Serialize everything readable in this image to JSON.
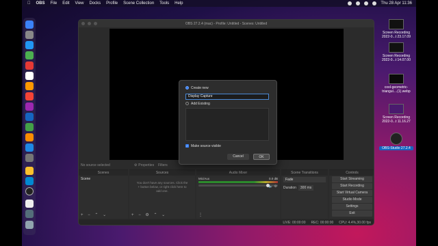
{
  "menubar": {
    "items": [
      "OBS",
      "File",
      "Edit",
      "View",
      "Docks",
      "Profile",
      "Scene Collection",
      "Tools",
      "Help"
    ],
    "clock": "Thu 28 Apr  11:36"
  },
  "obs": {
    "window_title": "OBS 27.2.4 (mac) - Profile: Untitled - Scenes: Untitled",
    "no_source": "No source selected",
    "properties_label": "Properties",
    "filters_label": "Filters",
    "docks": {
      "scenes_title": "Scenes",
      "scene_item": "Scene",
      "sources_title": "Sources",
      "sources_empty": "You don't have any sources. Click the + button below, or right click here to add one.",
      "mixer_title": "Audio Mixer",
      "mixer_track": "Mic/Aux",
      "mixer_db": "0.0 dB",
      "transitions_title": "Scene Transitions",
      "transition_value": "Fade",
      "duration_label": "Duration",
      "duration_value": "300 ms",
      "controls_title": "Controls",
      "controls": [
        "Start Streaming",
        "Start Recording",
        "Start Virtual Camera",
        "Studio Mode",
        "Settings",
        "Exit"
      ]
    },
    "status": {
      "live": "LIVE: 00:00:00",
      "rec": "REC: 00:00:00",
      "cpu": "CPU: 4.4%,30.00 fps"
    }
  },
  "dialog": {
    "create_new": "Create new",
    "name_value": "Display Capture",
    "add_existing": "Add Existing",
    "make_visible": "Make source visible",
    "cancel": "Cancel",
    "ok": "OK"
  },
  "desktop": [
    {
      "name": "Screen Recording\n2022-0...t 23.17.09"
    },
    {
      "name": "Screen Recording\n2022-0...t 14.07.00"
    },
    {
      "name": "cool-geometric-\ntriangul....(1).webp"
    },
    {
      "name": "Screen Recording\n2022-0...t 11.16.27"
    },
    {
      "name": "OBS-Studio 27.2.4"
    }
  ]
}
